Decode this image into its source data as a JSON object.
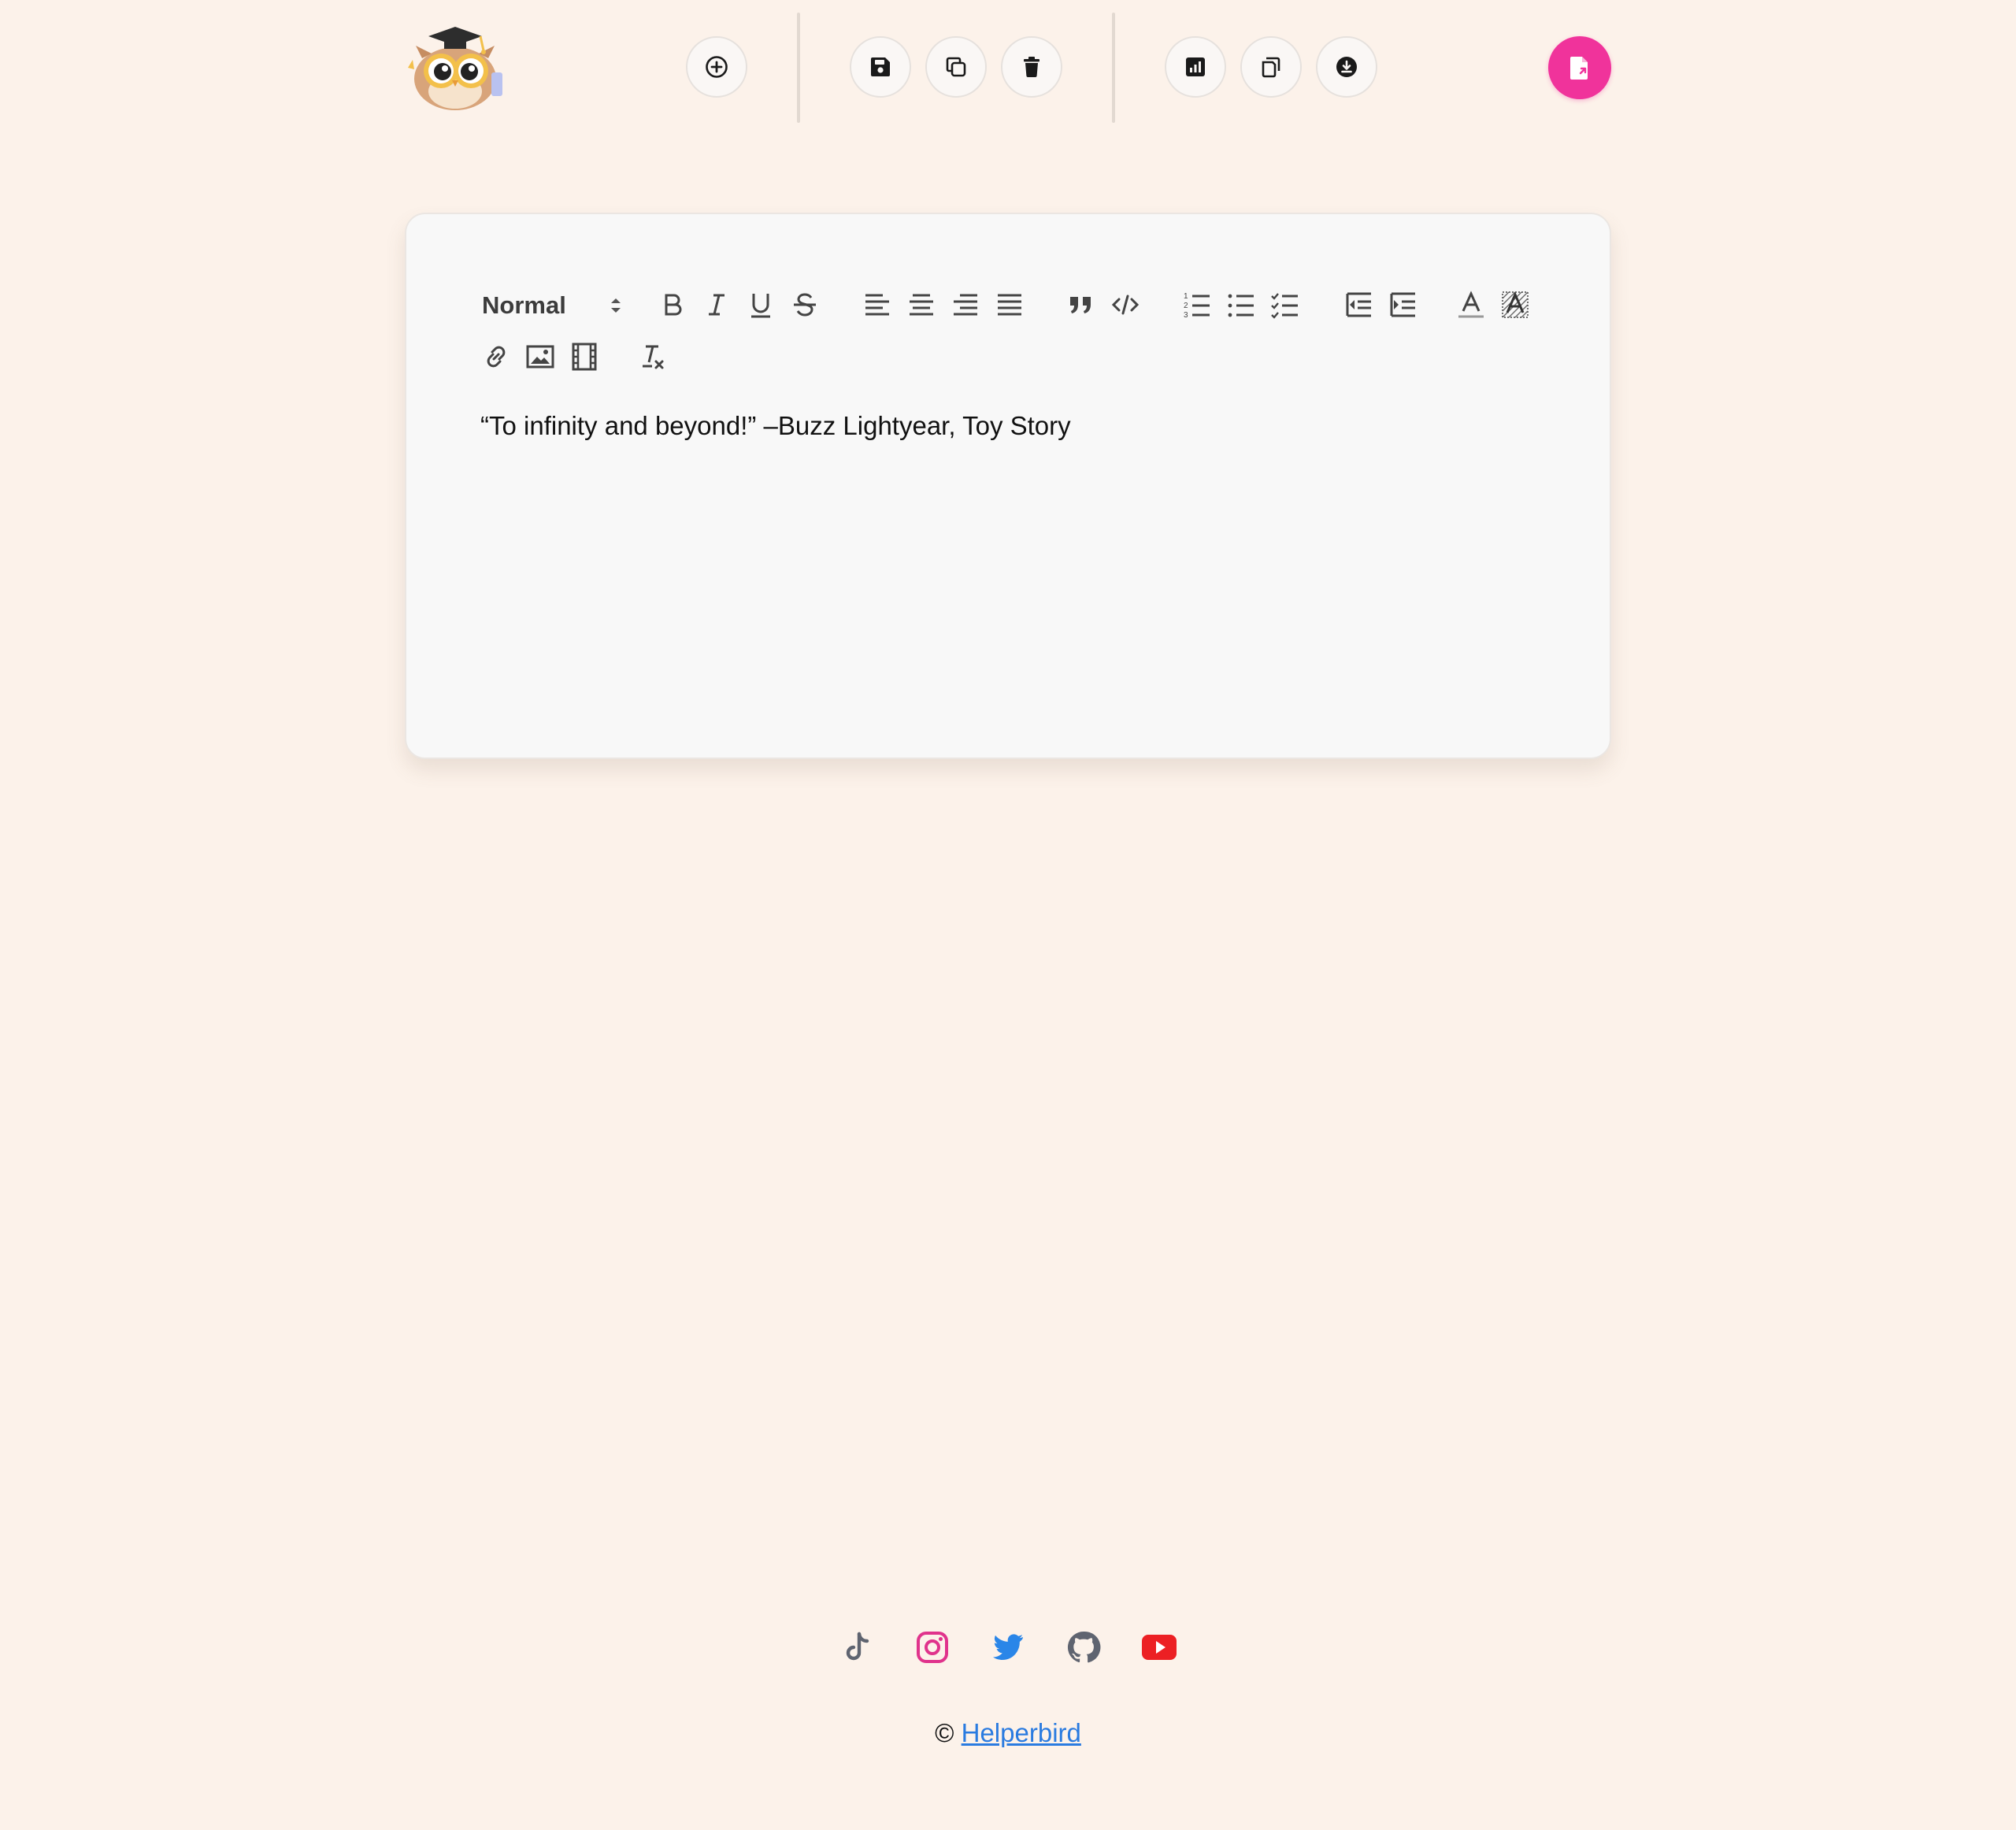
{
  "toolbar": {
    "logo_icon": "owl-graduate-logo",
    "groups": [
      [
        {
          "icon": "plus-circle-icon"
        }
      ],
      [
        {
          "icon": "save-icon"
        },
        {
          "icon": "copy-icon"
        },
        {
          "icon": "trash-icon"
        }
      ],
      [
        {
          "icon": "chart-report-icon"
        },
        {
          "icon": "duplicate-icon"
        },
        {
          "icon": "download-icon"
        }
      ]
    ],
    "action_icon": "file-export-icon",
    "accent_color": "#f0339b"
  },
  "editor": {
    "format_select": {
      "value": "Normal"
    },
    "tools": [
      "bold",
      "italic",
      "underline",
      "strikethrough",
      "align-left",
      "align-center",
      "align-right",
      "align-justify",
      "blockquote",
      "code",
      "ordered-list",
      "bullet-list",
      "check-list",
      "outdent",
      "indent",
      "text-color",
      "background-color",
      "link",
      "image",
      "video",
      "clear-format"
    ],
    "content": "“To infinity and beyond!” –Buzz Lightyear, Toy Story"
  },
  "footer": {
    "socials": [
      {
        "icon": "tiktok-icon",
        "color": "#5f6470"
      },
      {
        "icon": "instagram-icon",
        "color": "#e0338c"
      },
      {
        "icon": "twitter-icon",
        "color": "#2a86e8"
      },
      {
        "icon": "github-icon",
        "color": "#5f6470"
      },
      {
        "icon": "youtube-icon",
        "color": "#ec2024"
      }
    ],
    "copyright_symbol": "©",
    "brand_link": "Helperbird",
    "link_color": "#2a7be0"
  },
  "colors": {
    "background": "#fcf2ea",
    "card": "#f8f8f8"
  }
}
